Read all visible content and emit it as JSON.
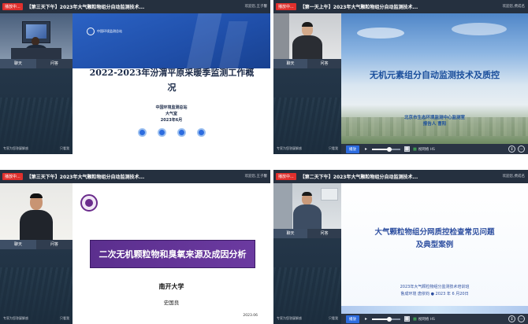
{
  "windows": [
    {
      "live_badge": "播放中...",
      "title": "【第三天下午】2023年大气颗粒物组分自动监测技术...",
      "welcome": "欢迎您,王子馨",
      "tabs": [
        "聊天",
        "问答"
      ],
      "footer_left": "专家为您答疑解惑",
      "footer_right": "只看我",
      "slide": {
        "org_header": "中国环境监测总站",
        "main_title": "2022-2023年汾渭平原采暖季监测工作概况",
        "org": "中国环境监测总站",
        "dept": "大气室",
        "date": "2023年6月"
      }
    },
    {
      "live_badge": "播放中...",
      "title": "【第一天上午】2023年大气颗粒物组分自动监测技术...",
      "welcome": "欢迎您,费成名",
      "tabs": [
        "聊天",
        "问答"
      ],
      "footer_left": "专家为您答疑解惑",
      "footer_right": "只看我",
      "controls": {
        "button": "播放",
        "signal": "视网络 HS"
      },
      "slide": {
        "main_title": "无机元素组分自动监测技术及质控",
        "org": "北京市生态环境监测中心监测室",
        "reporter": "报告人 曹阳"
      }
    },
    {
      "live_badge": "播放中...",
      "title": "【第三天下午】2023年大气颗粒物组分自动监测技术...",
      "welcome": "欢迎您,王子馨",
      "tabs": [
        "聊天",
        "问答"
      ],
      "footer_left": "专家为您答疑解惑",
      "footer_right": "只看我",
      "slide": {
        "main_title": "二次无机颗粒物和臭氧来源及成因分析",
        "org": "南开大学",
        "presenter": "史国良",
        "date": "2023.06"
      }
    },
    {
      "live_badge": "播放中...",
      "title": "【第二天下午】2023年大气颗粒物组分自动监测技术...",
      "welcome": "欢迎您,费成名",
      "tabs": [
        "聊天",
        "问答"
      ],
      "footer_left": "专家为您答疑解惑",
      "footer_right": "只看我",
      "controls": {
        "button": "播放",
        "signal": "视网络 HS"
      },
      "slide": {
        "main_title_line1": "大气颗粒物组分网质控检查常见问题",
        "main_title_line2": "及典型案例",
        "event": "2023年大气颗粒物组分监测技术培训班",
        "presenter_line": "鲁成环境  唐依钧 ● 2023 年 6 月20日"
      }
    }
  ],
  "colors": {
    "titlebar": "#25303f",
    "live_badge": "#e0302d",
    "slide1_banner": "#1f4ea8",
    "slide2_title": "#1b4f9c",
    "slide3_title_bg": "#5b2f8e",
    "slide4_title": "#2e4fa0",
    "nankai_seal": "#6a2c8c"
  }
}
